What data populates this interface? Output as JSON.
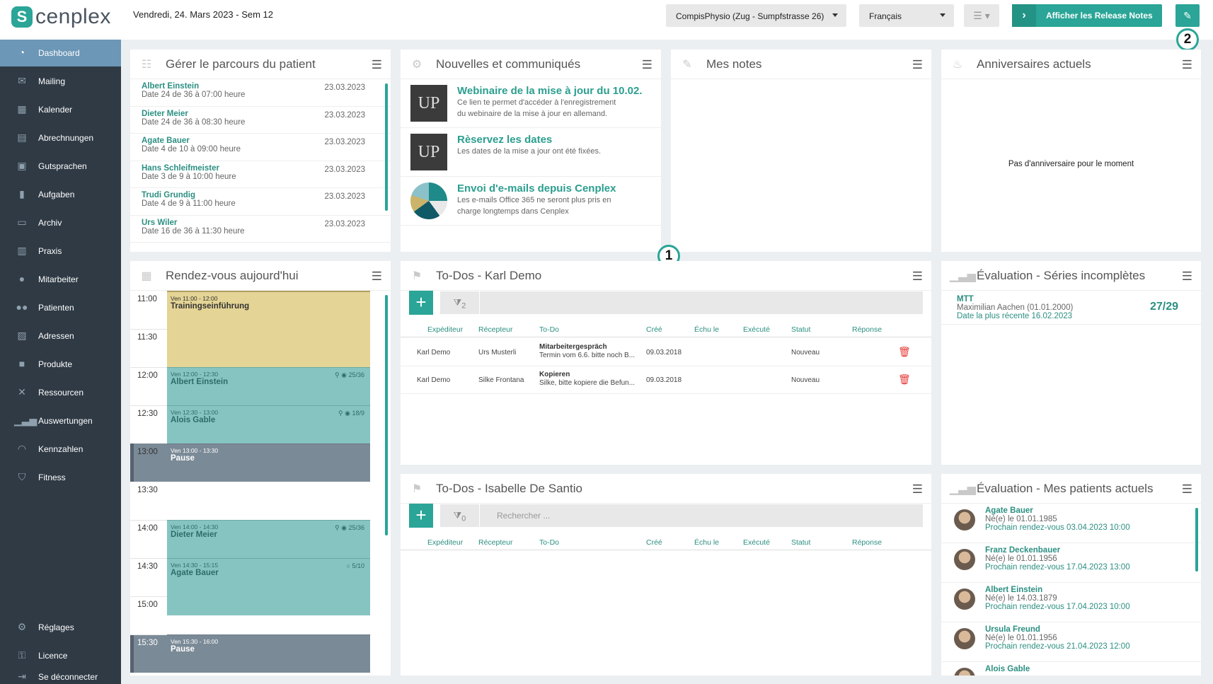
{
  "header": {
    "logo_text": "cenplex",
    "date": "Vendredi, 24. Mars 2023 - Sem 12",
    "location": "CompisPhysio (Zug - Sumpfstrasse 26)",
    "language": "Français",
    "release_notes": "Afficher les Release Notes",
    "marker_1": "1",
    "marker_2": "2"
  },
  "sidebar": {
    "items": [
      {
        "label": "Dashboard",
        "icon": "dashboard-icon"
      },
      {
        "label": "Mailing",
        "icon": "mail-icon"
      },
      {
        "label": "Kalender",
        "icon": "calendar-icon"
      },
      {
        "label": "Abrechnungen",
        "icon": "calculator-icon"
      },
      {
        "label": "Gutsprachen",
        "icon": "document-icon"
      },
      {
        "label": "Aufgaben",
        "icon": "clipboard-icon"
      },
      {
        "label": "Archiv",
        "icon": "archive-icon"
      },
      {
        "label": "Praxis",
        "icon": "building-icon"
      },
      {
        "label": "Mitarbeiter",
        "icon": "staff-icon"
      },
      {
        "label": "Patienten",
        "icon": "patients-icon"
      },
      {
        "label": "Adressen",
        "icon": "address-book-icon"
      },
      {
        "label": "Produkte",
        "icon": "box-icon"
      },
      {
        "label": "Ressourcen",
        "icon": "tools-icon"
      },
      {
        "label": "Auswertungen",
        "icon": "chart-icon"
      },
      {
        "label": "Kennzahlen",
        "icon": "gauge-icon"
      },
      {
        "label": "Fitness",
        "icon": "shield-icon"
      }
    ],
    "bottom": [
      {
        "label": "Réglages",
        "icon": "gear-icon"
      },
      {
        "label": "Licence",
        "icon": "key-icon"
      },
      {
        "label": "Se déconnecter",
        "icon": "logout-icon"
      }
    ]
  },
  "patient_path": {
    "title": "Gérer le parcours du patient",
    "rows": [
      {
        "name": "Albert Einstein",
        "sub": "Date 24 de 36 à 07:00 heure",
        "date": "23.03.2023"
      },
      {
        "name": "Dieter Meier",
        "sub": "Date 24 de 36 à 08:30 heure",
        "date": "23.03.2023"
      },
      {
        "name": "Agate Bauer",
        "sub": "Date 4 de 10 à 09:00 heure",
        "date": "23.03.2023"
      },
      {
        "name": "Hans Schleifmeister",
        "sub": "Date 3 de 9 à 10:00 heure",
        "date": "23.03.2023"
      },
      {
        "name": "Trudi Grundig",
        "sub": "Date 4 de 9 à 11:00 heure",
        "date": "23.03.2023"
      },
      {
        "name": "Urs Wiler",
        "sub": "Date 16 de 36 à 11:30 heure",
        "date": "23.03.2023"
      }
    ]
  },
  "news": {
    "title": "Nouvelles et communiqués",
    "items": [
      {
        "title": "Webinaire de la mise à jour du 10.02...",
        "desc1": "Ce lien te permet d'accéder à l'enregistrement",
        "desc2": "du webinaire de la mise à jour en allemand."
      },
      {
        "title": "Rèservez les dates",
        "desc1": "Les dates de la mise a jour ont été fixées.",
        "desc2": ""
      },
      {
        "title": "Envoi d'e-mails depuis Cenplex",
        "desc1": "Les e-mails Office 365 ne seront plus pris en",
        "desc2": "charge longtemps dans Cenplex"
      }
    ]
  },
  "notes": {
    "title": "Mes notes"
  },
  "birthdays": {
    "title": "Anniversaires actuels",
    "empty": "Pas d'anniversaire pour le moment"
  },
  "appointments": {
    "title": "Rendez-vous aujourd'hui",
    "times": [
      "11:00",
      "11:30",
      "12:00",
      "12:30",
      "13:00",
      "13:30",
      "14:00",
      "14:30",
      "15:00",
      "15:30"
    ],
    "items": [
      {
        "time": "Ven 11:00 - 12:00",
        "name": "Trainingseinführung",
        "status": ""
      },
      {
        "time": "Ven 12:00 - 12:30",
        "name": "Albert Einstein",
        "status": "25/36"
      },
      {
        "time": "Ven 12:30 - 13:00",
        "name": "Alois Gable",
        "status": "18/9"
      },
      {
        "time": "Ven 13:00 - 13:30",
        "name": "Pause",
        "status": ""
      },
      {
        "time": "Ven 14:00 - 14:30",
        "name": "Dieter Meier",
        "status": "25/36"
      },
      {
        "time": "Ven 14:30 - 15:15",
        "name": "Agate Bauer",
        "status": "5/10"
      },
      {
        "time": "Ven 15:30 - 16:00",
        "name": "Pause",
        "status": ""
      }
    ]
  },
  "todos_karl": {
    "title": "To-Dos - Karl Demo",
    "filter_count": "2",
    "columns": [
      "Expéditeur",
      "Récepteur",
      "To-Do",
      "Créé",
      "Échu le",
      "Exécuté",
      "Statut",
      "Réponse"
    ],
    "rows": [
      {
        "sender": "Karl Demo",
        "receiver": "Urs Musterli",
        "todo_title": "Mitarbeitergespräch",
        "todo_text": "Termin vom 6.6. bitte noch B...",
        "created": "09.03.2018",
        "status": "Nouveau"
      },
      {
        "sender": "Karl Demo",
        "receiver": "Silke Frontana",
        "todo_title": "Kopieren",
        "todo_text": "Silke, bitte kopiere die Befun...",
        "created": "09.03.2018",
        "status": "Nouveau"
      }
    ]
  },
  "todos_isabelle": {
    "title": "To-Dos - Isabelle De Santio",
    "filter_count": "0",
    "search_placeholder": "Rechercher ...",
    "columns": [
      "Expéditeur",
      "Récepteur",
      "To-Do",
      "Créé",
      "Échu le",
      "Exécuté",
      "Statut",
      "Réponse"
    ]
  },
  "eval_series": {
    "title": "Évaluation - Séries incomplètes",
    "label": "MTT",
    "patient": "Maximilian Aachen (01.01.2000)",
    "date": "Date la plus récente 16.02.2023",
    "score": "27/29"
  },
  "eval_patients": {
    "title": "Évaluation - Mes patients actuels",
    "rows": [
      {
        "name": "Agate Bauer",
        "born": "Né(e) le 01.01.1985",
        "next": "Prochain rendez-vous 03.04.2023 10:00"
      },
      {
        "name": "Franz Deckenbauer",
        "born": "Né(e) le 01.01.1956",
        "next": "Prochain rendez-vous 17.04.2023 13:00"
      },
      {
        "name": "Albert Einstein",
        "born": "Né(e) le 14.03.1879",
        "next": "Prochain rendez-vous 17.04.2023 10:00"
      },
      {
        "name": "Ursula Freund",
        "born": "Né(e) le 01.01.1956",
        "next": "Prochain rendez-vous 21.04.2023 12:00"
      },
      {
        "name": "Alois Gable",
        "born": "",
        "next": ""
      }
    ]
  },
  "colors": {
    "accent": "#2aa597",
    "sidebar": "#2f3a45",
    "active": "#6c97b6",
    "trash": "#e53935"
  }
}
